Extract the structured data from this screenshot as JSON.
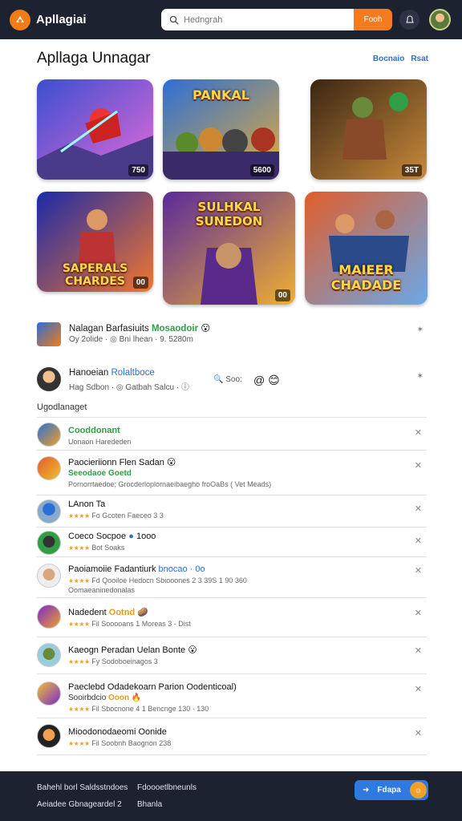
{
  "app": {
    "name": "Apllagiai"
  },
  "search": {
    "placeholder": "Hedngrah",
    "button_label": "Fooh"
  },
  "section": {
    "title": "Apllaga Unnagar",
    "links": [
      "Bocnaio",
      "Rsat"
    ]
  },
  "tiles": [
    {
      "banner": "",
      "badge": "750",
      "colors": [
        "#3b4fd0",
        "#e56ad8"
      ]
    },
    {
      "banner": "PANKAL",
      "badge": "5600",
      "colors": [
        "#2c6fd6",
        "#f0b030"
      ]
    },
    {
      "banner": "",
      "badge": "35T",
      "colors": [
        "#3a2614",
        "#c98a3a"
      ]
    },
    {
      "banner": "SAPERALS CHARDES",
      "badge": "00",
      "colors": [
        "#1b2aa8",
        "#ff7a28"
      ]
    },
    {
      "banner": "SULHKAL SUNEDON",
      "badge": "00",
      "colors": [
        "#5a2a9c",
        "#f0b030"
      ]
    },
    {
      "banner": "MAIEER CHADADE",
      "badge": "",
      "colors": [
        "#e05d2b",
        "#6aa8e8"
      ]
    }
  ],
  "featured": [
    {
      "title": "Nalagan Barfasiuits",
      "title_accent": "Mosaodoir",
      "sub": "Oy 2olide · ◎ Bni lhean · 9. 5280m",
      "close": "✶"
    },
    {
      "title": "Hanoeian",
      "title_accent": "Rolaltboce",
      "sub": "Hag Sdbon · ◎ Gatbah Salcu · ⓘ",
      "extra": "Soo:",
      "close": "✶"
    }
  ],
  "list_label": "Ugodlanaget",
  "items": [
    {
      "title": "Cooddonant",
      "line2": "Uonaon Harededen",
      "stars": false,
      "tag": ""
    },
    {
      "title": "Paocieriionn Flen Sadan",
      "tag": "Seeodaoe Goetd",
      "line2": "Pornorrtaedoe; Grocderloplornaeibaegho froOaBs ( Vet Meads)",
      "stars": false
    },
    {
      "title": "LAnon Ta",
      "line2": "Fo Gcoten Faeceo 3 3",
      "stars": true,
      "tag": ""
    },
    {
      "title": "Coeco Socpoe",
      "tag": "1ooo",
      "line2": "Bot Soaks",
      "stars": true
    },
    {
      "title": "Paoiamoiie Fadantiurk",
      "tag": "bnocao · 0o",
      "line2": "Fd Qooiloe Hedocn Sbiooones 2 3 39S 1 90 360",
      "line3": "Oomaeaninedonalas",
      "stars": true
    },
    {
      "title": "Nadedent",
      "tag": "Ootnd",
      "line2": "Fil Sooooans 1 Moreas 3 - Dist",
      "stars": true
    },
    {
      "title": "Kaeogn Peradan Uelan Bonte",
      "tag": "",
      "line2": "Fy Sodoboeinagos 3",
      "stars": true
    },
    {
      "title": "Paeclebd Odadekoarn Parion Oodenticoal)",
      "tag": "Ooon",
      "line2": "Fil Sbocnone 4 1 Bencnge 130 · 130",
      "stars": true
    },
    {
      "title": "Mioodonodaeomi Oonide",
      "tag": "",
      "line2": "Fil Soobnh Baognon 238",
      "stars": true
    }
  ],
  "footer": {
    "col1": [
      "Bahehl borl Saldsstndoes",
      "Aeiadee Gbnageardel 2"
    ],
    "col2": [
      "Fdoooetlbneunls",
      "Bhanla"
    ],
    "cta": "Fdapa"
  },
  "colors": {
    "topbar": "#1d2230",
    "accent": "#f47b20",
    "link": "#2b6fd6"
  }
}
